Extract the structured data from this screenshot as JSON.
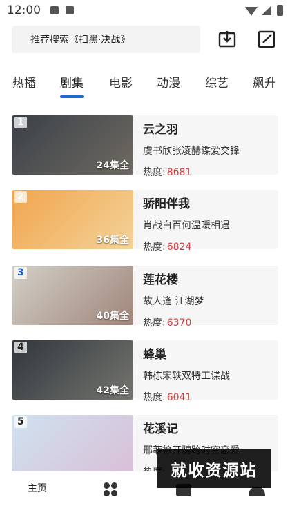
{
  "status_bar": {
    "time": "12:00"
  },
  "search": {
    "placeholder_text": "推荐搜索《扫黑·决战》"
  },
  "tabs": [
    {
      "label": "热播"
    },
    {
      "label": "剧集"
    },
    {
      "label": "电影"
    },
    {
      "label": "动漫"
    },
    {
      "label": "综艺"
    },
    {
      "label": "飙升"
    }
  ],
  "active_tab": "剧集",
  "heat_label": "热度:",
  "list": [
    {
      "rank": "1",
      "title": "云之羽",
      "desc": "虞书欣张凌赫谍爱交锋",
      "heat": "8681",
      "episodes": "24集全",
      "thumb_colors": [
        "#3a4048",
        "#6f6a62"
      ]
    },
    {
      "rank": "2",
      "title": "骄阳伴我",
      "desc": "肖战白百何温暖相遇",
      "heat": "6824",
      "episodes": "36集全",
      "thumb_colors": [
        "#f1a54d",
        "#f3d39a"
      ]
    },
    {
      "rank": "3",
      "title": "莲花楼",
      "desc": "故人逢 江湖梦",
      "heat": "6370",
      "episodes": "40集全",
      "thumb_colors": [
        "#d3d0c8",
        "#9f857a"
      ]
    },
    {
      "rank": "4",
      "title": "蜂巢",
      "desc": "韩栋宋轶双特工谍战",
      "heat": "6041",
      "episodes": "42集全",
      "thumb_colors": [
        "#30363d",
        "#75756f"
      ]
    },
    {
      "rank": "5",
      "title": "花溪记",
      "desc": "邢菲徐开骋跨时空恋爱",
      "heat": "",
      "episodes": "",
      "thumb_colors": [
        "#cfe2ef",
        "#d9bfd7"
      ]
    }
  ],
  "bottom_nav": {
    "home_label": "主页"
  },
  "watermark": "就收资源站",
  "colors": {
    "accent": "#1f67d6",
    "heat_number": "#d63a3a",
    "card_bg": "#f6f6f6"
  }
}
